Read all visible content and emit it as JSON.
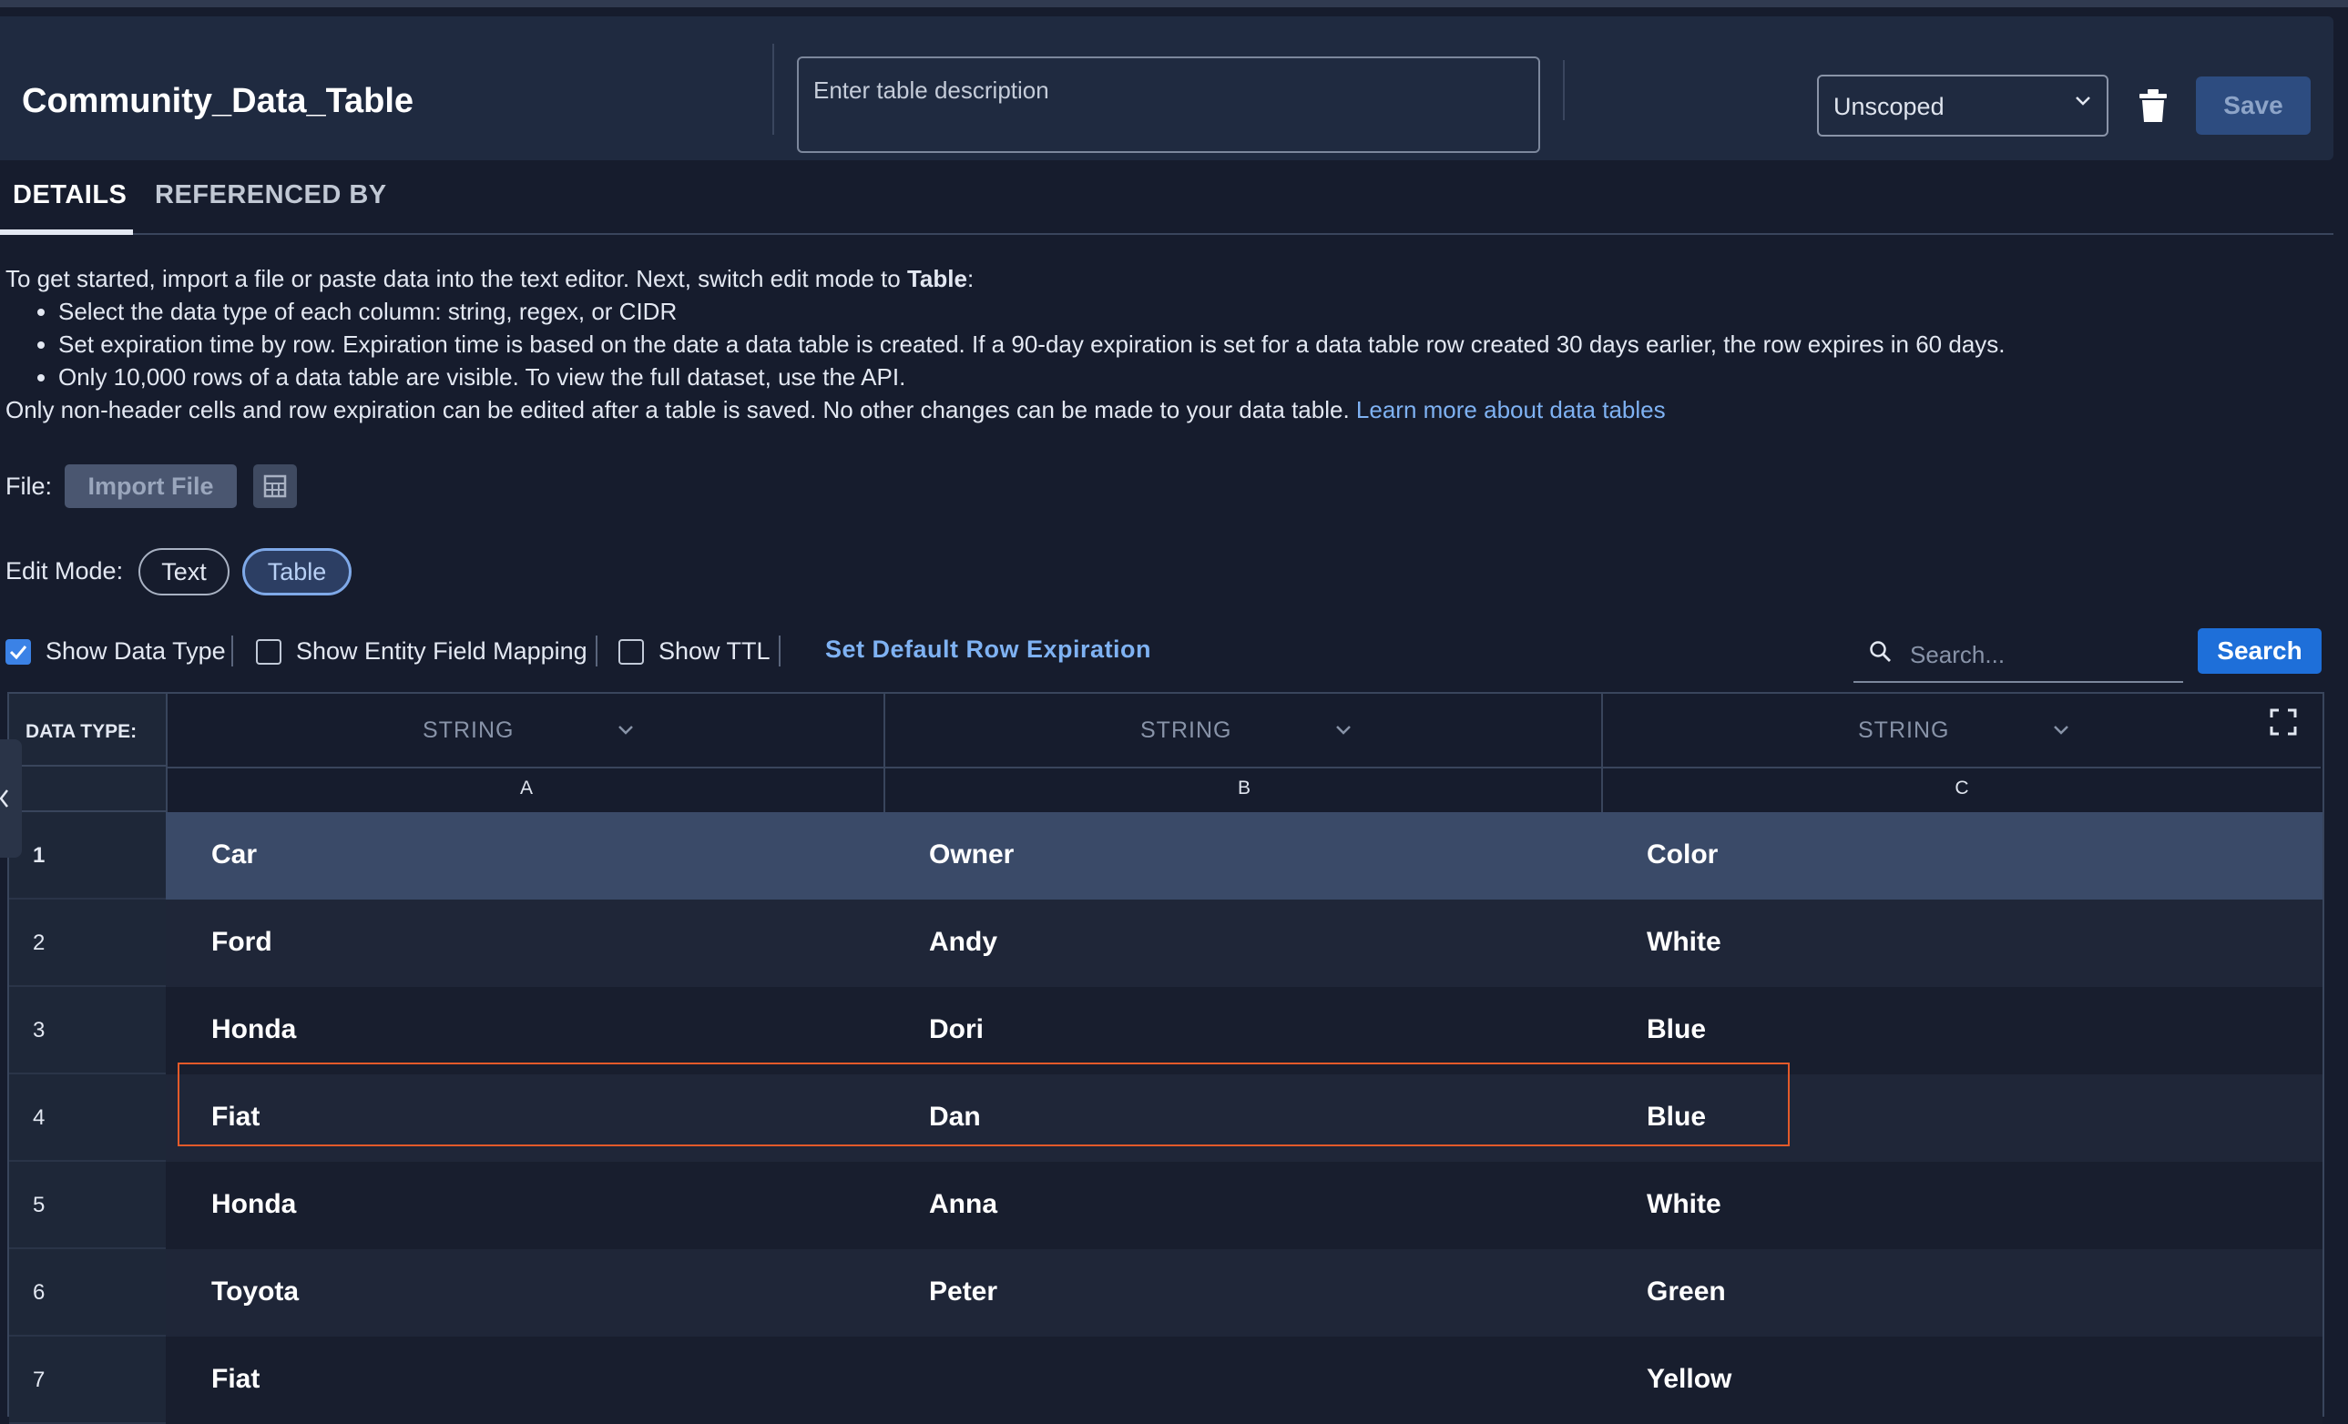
{
  "header": {
    "title": "Community_Data_Table",
    "description_placeholder": "Enter table description",
    "scope": "Unscoped",
    "save_label": "Save"
  },
  "tabs": [
    {
      "label": "DETAILS",
      "active": true
    },
    {
      "label": "REFERENCED BY",
      "active": false
    }
  ],
  "intro": {
    "lead": "To get started, import a file or paste data into the text editor. Next, switch edit mode to ",
    "lead_bold": "Table",
    "lead_end": ":",
    "bullets": [
      "Select the data type of each column: string, regex, or CIDR",
      "Set expiration time by row. Expiration time is based on the date a data table is created. If a 90-day expiration is set for a data table row created 30 days earlier, the row expires in 60 days.",
      "Only 10,000 rows of a data table are visible. To view the full dataset, use the API."
    ],
    "note": "Only non-header cells and row expiration can be edited after a table is saved. No other changes can be made to your data table. ",
    "link": "Learn more about data tables"
  },
  "file": {
    "label": "File:",
    "import_label": "Import File"
  },
  "edit_mode": {
    "label": "Edit Mode:",
    "options": [
      "Text",
      "Table"
    ],
    "selected": "Table"
  },
  "options": {
    "show_data_type": {
      "label": "Show Data Type",
      "checked": true
    },
    "show_entity_mapping": {
      "label": "Show Entity Field Mapping",
      "checked": false
    },
    "show_ttl": {
      "label": "Show TTL",
      "checked": false
    },
    "set_expiration": "Set Default Row Expiration",
    "search_placeholder": "Search...",
    "search_button": "Search"
  },
  "colors": {
    "accent": "#1e6fd9",
    "link": "#7fb2f3",
    "highlight_border": "#e35a2a",
    "header_row_bg": "#3a4a68"
  },
  "grid": {
    "data_type_label": "DATA TYPE:",
    "columns": [
      {
        "letter": "A",
        "type": "STRING"
      },
      {
        "letter": "B",
        "type": "STRING"
      },
      {
        "letter": "C",
        "type": "STRING"
      }
    ],
    "rows": [
      {
        "num": "1",
        "cells": [
          "Car",
          "Owner",
          "Color"
        ]
      },
      {
        "num": "2",
        "cells": [
          "Ford",
          "Andy",
          "White"
        ]
      },
      {
        "num": "3",
        "cells": [
          "Honda",
          "Dori",
          "Blue"
        ]
      },
      {
        "num": "4",
        "cells": [
          "Fiat",
          "Dan",
          "Blue"
        ]
      },
      {
        "num": "5",
        "cells": [
          "Honda",
          "Anna",
          "White"
        ]
      },
      {
        "num": "6",
        "cells": [
          "Toyota",
          "Peter",
          "Green"
        ]
      },
      {
        "num": "7",
        "cells": [
          "Fiat",
          "",
          "Yellow"
        ]
      }
    ]
  }
}
